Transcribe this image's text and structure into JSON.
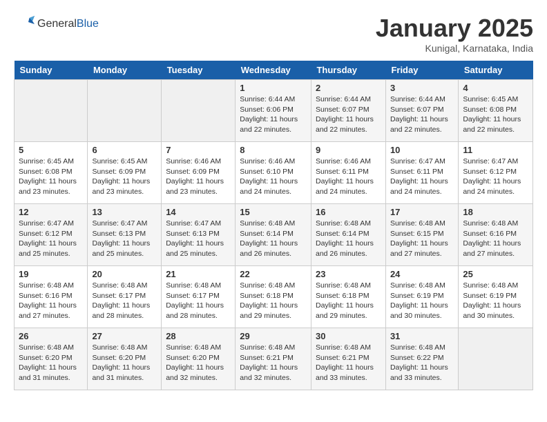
{
  "header": {
    "logo_general": "General",
    "logo_blue": "Blue",
    "month": "January 2025",
    "location": "Kunigal, Karnataka, India"
  },
  "days_of_week": [
    "Sunday",
    "Monday",
    "Tuesday",
    "Wednesday",
    "Thursday",
    "Friday",
    "Saturday"
  ],
  "weeks": [
    [
      {
        "day": "",
        "info": ""
      },
      {
        "day": "",
        "info": ""
      },
      {
        "day": "",
        "info": ""
      },
      {
        "day": "1",
        "info": "Sunrise: 6:44 AM\nSunset: 6:06 PM\nDaylight: 11 hours\nand 22 minutes."
      },
      {
        "day": "2",
        "info": "Sunrise: 6:44 AM\nSunset: 6:07 PM\nDaylight: 11 hours\nand 22 minutes."
      },
      {
        "day": "3",
        "info": "Sunrise: 6:44 AM\nSunset: 6:07 PM\nDaylight: 11 hours\nand 22 minutes."
      },
      {
        "day": "4",
        "info": "Sunrise: 6:45 AM\nSunset: 6:08 PM\nDaylight: 11 hours\nand 22 minutes."
      }
    ],
    [
      {
        "day": "5",
        "info": "Sunrise: 6:45 AM\nSunset: 6:08 PM\nDaylight: 11 hours\nand 23 minutes."
      },
      {
        "day": "6",
        "info": "Sunrise: 6:45 AM\nSunset: 6:09 PM\nDaylight: 11 hours\nand 23 minutes."
      },
      {
        "day": "7",
        "info": "Sunrise: 6:46 AM\nSunset: 6:09 PM\nDaylight: 11 hours\nand 23 minutes."
      },
      {
        "day": "8",
        "info": "Sunrise: 6:46 AM\nSunset: 6:10 PM\nDaylight: 11 hours\nand 24 minutes."
      },
      {
        "day": "9",
        "info": "Sunrise: 6:46 AM\nSunset: 6:11 PM\nDaylight: 11 hours\nand 24 minutes."
      },
      {
        "day": "10",
        "info": "Sunrise: 6:47 AM\nSunset: 6:11 PM\nDaylight: 11 hours\nand 24 minutes."
      },
      {
        "day": "11",
        "info": "Sunrise: 6:47 AM\nSunset: 6:12 PM\nDaylight: 11 hours\nand 24 minutes."
      }
    ],
    [
      {
        "day": "12",
        "info": "Sunrise: 6:47 AM\nSunset: 6:12 PM\nDaylight: 11 hours\nand 25 minutes."
      },
      {
        "day": "13",
        "info": "Sunrise: 6:47 AM\nSunset: 6:13 PM\nDaylight: 11 hours\nand 25 minutes."
      },
      {
        "day": "14",
        "info": "Sunrise: 6:47 AM\nSunset: 6:13 PM\nDaylight: 11 hours\nand 25 minutes."
      },
      {
        "day": "15",
        "info": "Sunrise: 6:48 AM\nSunset: 6:14 PM\nDaylight: 11 hours\nand 26 minutes."
      },
      {
        "day": "16",
        "info": "Sunrise: 6:48 AM\nSunset: 6:14 PM\nDaylight: 11 hours\nand 26 minutes."
      },
      {
        "day": "17",
        "info": "Sunrise: 6:48 AM\nSunset: 6:15 PM\nDaylight: 11 hours\nand 27 minutes."
      },
      {
        "day": "18",
        "info": "Sunrise: 6:48 AM\nSunset: 6:16 PM\nDaylight: 11 hours\nand 27 minutes."
      }
    ],
    [
      {
        "day": "19",
        "info": "Sunrise: 6:48 AM\nSunset: 6:16 PM\nDaylight: 11 hours\nand 27 minutes."
      },
      {
        "day": "20",
        "info": "Sunrise: 6:48 AM\nSunset: 6:17 PM\nDaylight: 11 hours\nand 28 minutes."
      },
      {
        "day": "21",
        "info": "Sunrise: 6:48 AM\nSunset: 6:17 PM\nDaylight: 11 hours\nand 28 minutes."
      },
      {
        "day": "22",
        "info": "Sunrise: 6:48 AM\nSunset: 6:18 PM\nDaylight: 11 hours\nand 29 minutes."
      },
      {
        "day": "23",
        "info": "Sunrise: 6:48 AM\nSunset: 6:18 PM\nDaylight: 11 hours\nand 29 minutes."
      },
      {
        "day": "24",
        "info": "Sunrise: 6:48 AM\nSunset: 6:19 PM\nDaylight: 11 hours\nand 30 minutes."
      },
      {
        "day": "25",
        "info": "Sunrise: 6:48 AM\nSunset: 6:19 PM\nDaylight: 11 hours\nand 30 minutes."
      }
    ],
    [
      {
        "day": "26",
        "info": "Sunrise: 6:48 AM\nSunset: 6:20 PM\nDaylight: 11 hours\nand 31 minutes."
      },
      {
        "day": "27",
        "info": "Sunrise: 6:48 AM\nSunset: 6:20 PM\nDaylight: 11 hours\nand 31 minutes."
      },
      {
        "day": "28",
        "info": "Sunrise: 6:48 AM\nSunset: 6:20 PM\nDaylight: 11 hours\nand 32 minutes."
      },
      {
        "day": "29",
        "info": "Sunrise: 6:48 AM\nSunset: 6:21 PM\nDaylight: 11 hours\nand 32 minutes."
      },
      {
        "day": "30",
        "info": "Sunrise: 6:48 AM\nSunset: 6:21 PM\nDaylight: 11 hours\nand 33 minutes."
      },
      {
        "day": "31",
        "info": "Sunrise: 6:48 AM\nSunset: 6:22 PM\nDaylight: 11 hours\nand 33 minutes."
      },
      {
        "day": "",
        "info": ""
      }
    ]
  ]
}
